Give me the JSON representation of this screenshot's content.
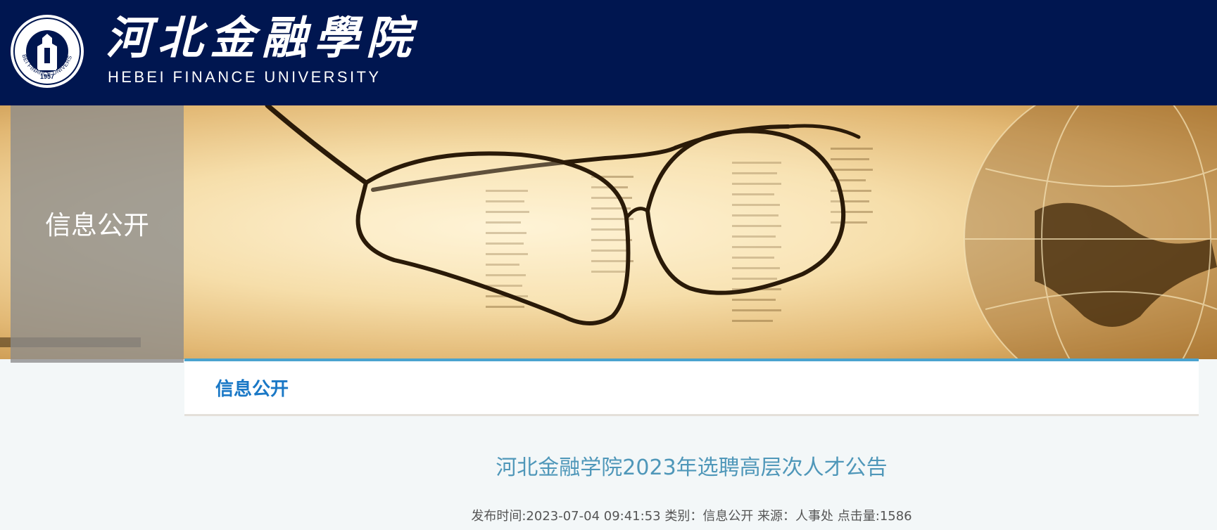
{
  "header": {
    "logo_seal_year": "1957",
    "logo_seal_text": "HEBEI FINANCE UNIVERSITY",
    "logo_name_cn": "河北金融學院",
    "logo_name_en": "HEBEI FINANCE UNIVERSITY",
    "background_color": "#001650"
  },
  "banner": {
    "side_title": "信息公开"
  },
  "section": {
    "title": "信息公开",
    "accent_color": "#4aa3cf"
  },
  "article": {
    "title": "河北金融学院2023年选聘高层次人才公告",
    "meta": "发布时间:2023-07-04 09:41:53 类别：信息公开 来源：人事处 点击量:1586"
  }
}
